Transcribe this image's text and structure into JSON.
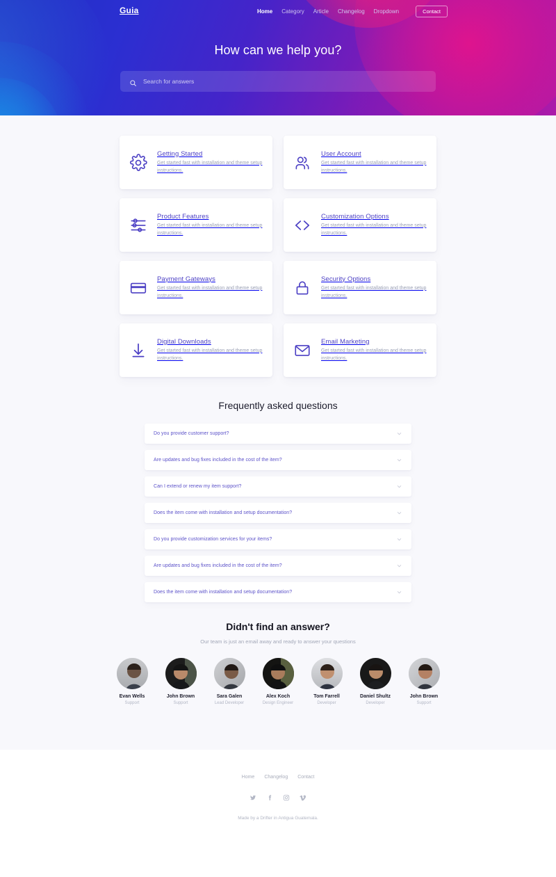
{
  "brand": "Guia",
  "nav": {
    "links": [
      {
        "label": "Home",
        "active": true
      },
      {
        "label": "Category",
        "active": false
      },
      {
        "label": "Article",
        "active": false
      },
      {
        "label": "Changelog",
        "active": false
      },
      {
        "label": "Dropdown",
        "active": false
      }
    ],
    "contact_label": "Contact"
  },
  "hero": {
    "title": "How can we help you?",
    "search_placeholder": "Search for answers",
    "search_value": "",
    "search_icon": "search-icon",
    "gradient_from": "#1f2fc4",
    "gradient_to": "#b61aa6"
  },
  "categories": [
    {
      "icon": "gear-icon",
      "title": "Getting Started",
      "desc": "Get started fast with installation and theme setup instructions."
    },
    {
      "icon": "users-icon",
      "title": "User Account",
      "desc": "Get started fast with installation and theme setup instructions."
    },
    {
      "icon": "sliders-icon",
      "title": "Product Features",
      "desc": "Get started fast with installation and theme setup instructions."
    },
    {
      "icon": "code-brackets-icon",
      "title": "Customization Options",
      "desc": "Get started fast with installation and theme setup instructions."
    },
    {
      "icon": "credit-card-icon",
      "title": "Payment Gateways",
      "desc": "Get started fast with installation and theme setup instructions."
    },
    {
      "icon": "lock-icon",
      "title": "Security Options",
      "desc": "Get started fast with installation and theme setup instructions."
    },
    {
      "icon": "download-icon",
      "title": "Digital Downloads",
      "desc": "Get started fast with installation and theme setup instructions."
    },
    {
      "icon": "envelope-icon",
      "title": "Email Marketing",
      "desc": "Get started fast with installation and theme setup instructions."
    }
  ],
  "faq": {
    "heading": "Frequently asked questions",
    "items": [
      {
        "question": "Do you provide customer support?"
      },
      {
        "question": "Are updates and bug fixes included in the cost of the item?"
      },
      {
        "question": "Can I extend or renew my item support?"
      },
      {
        "question": "Does the item come with installation and setup documentation?"
      },
      {
        "question": "Do you provide customization services for your items?"
      },
      {
        "question": "Are updates and bug fixes included in the cost of the item?"
      },
      {
        "question": "Does the item come with installation and setup documentation?"
      }
    ],
    "toggle_icon": "chevron-down-icon"
  },
  "team": {
    "heading": "Didn't find an answer?",
    "subtitle": "Our team is just an email away and ready to answer your questions",
    "members": [
      {
        "name": "Evan Wells",
        "role": "Support"
      },
      {
        "name": "John Brown",
        "role": "Support"
      },
      {
        "name": "Sara Galen",
        "role": "Lead Developer"
      },
      {
        "name": "Alex Koch",
        "role": "Design Engineer"
      },
      {
        "name": "Tom Farrell",
        "role": "Developer"
      },
      {
        "name": "Daniel Shultz",
        "role": "Developer"
      },
      {
        "name": "John Brown",
        "role": "Support"
      }
    ]
  },
  "footer": {
    "links": [
      {
        "label": "Home"
      },
      {
        "label": "Changelog"
      },
      {
        "label": "Contact"
      }
    ],
    "socials": [
      {
        "name": "twitter-icon"
      },
      {
        "name": "facebook-icon"
      },
      {
        "name": "instagram-icon"
      },
      {
        "name": "vimeo-icon"
      }
    ],
    "credit": "Made by a Drifter in Antigua Guatemala."
  },
  "colors": {
    "accent": "#4b3fc4",
    "faq_text": "#5b51c9",
    "body_bg": "#f8f8fc"
  }
}
